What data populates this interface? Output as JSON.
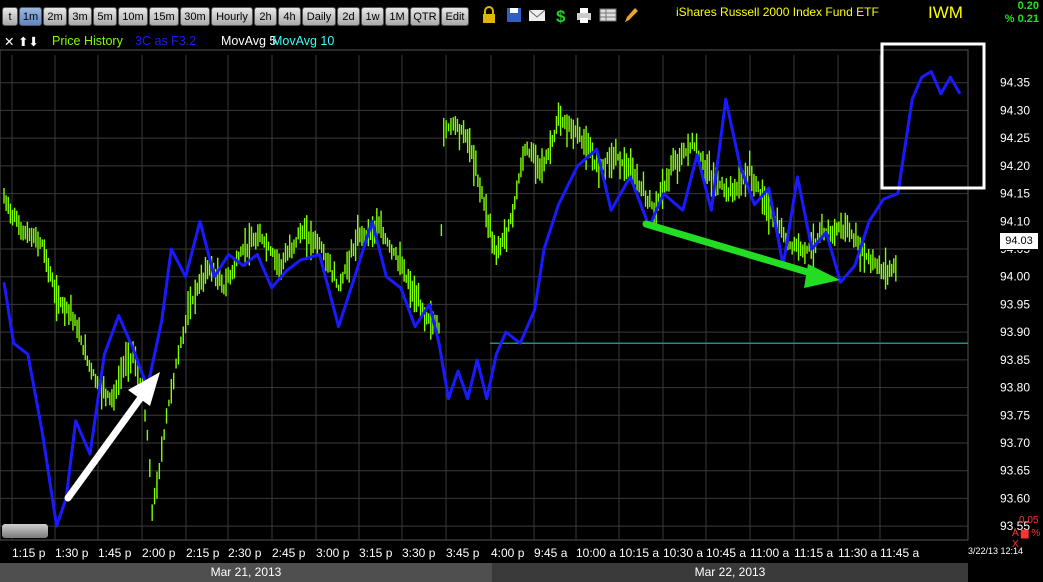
{
  "toolbar": {
    "timeframes": [
      "t",
      "1m",
      "2m",
      "3m",
      "5m",
      "10m",
      "15m",
      "30m",
      "Hourly",
      "2h",
      "4h",
      "Daily",
      "2d",
      "1w",
      "1M",
      "QTR",
      "Edit"
    ],
    "active": "1m",
    "icons": [
      "lock-icon",
      "save-icon",
      "mail-icon",
      "dollar-icon",
      "print-icon",
      "table-icon",
      "pencil-icon"
    ]
  },
  "header": {
    "title": "iShares Russell 2000 Index Fund ETF",
    "symbol": "IWM",
    "change_abs": "0.20",
    "change_pct": "% 0.21"
  },
  "legend": {
    "controls": "✕ ⬆⬇",
    "price_history": "Price History",
    "indicator": "3C as F3.2",
    "ma5": "MovAvg 5",
    "ma10": "MovAvg 10"
  },
  "last_price": "94.03",
  "footer": {
    "date1": "Mar 21, 2013",
    "date2": "Mar 22, 2013",
    "corner_date": "3/22/13 12:14",
    "neg_change": "0.05",
    "alert_marks": "A ▆ % X"
  },
  "colors": {
    "price": "#7fff00",
    "indicator": "#1a1aff",
    "grid": "#3a3a3a",
    "teal_line": "#1f8f80",
    "white_arrow": "#ffffff",
    "green_arrow": "#22dd22",
    "box": "#ffffff"
  },
  "chart_data": {
    "type": "line",
    "y_ticks": [
      "94.35",
      "94.30",
      "94.25",
      "94.20",
      "94.15",
      "94.10",
      "94.05",
      "94.00",
      "93.95",
      "93.90",
      "93.85",
      "93.80",
      "93.75",
      "93.70",
      "93.65",
      "93.60",
      "93.55"
    ],
    "ylim": [
      93.525,
      94.4
    ],
    "x_ticks": [
      "1:15 p",
      "1:30 p",
      "1:45 p",
      "2:00 p",
      "2:15 p",
      "2:30 p",
      "2:45 p",
      "3:00 p",
      "3:15 p",
      "3:30 p",
      "3:45 p",
      "4:00 p",
      "9:45 a",
      "10:00 a",
      "10:15 a",
      "10:30 a",
      "10:45 a",
      "11:00 a",
      "11:15 a",
      "11:30 a",
      "11:45 a"
    ],
    "price_series": [
      {
        "t": 0,
        "v": 94.14
      },
      {
        "t": 4,
        "v": 94.08
      },
      {
        "t": 8,
        "v": 94.06
      },
      {
        "t": 11,
        "v": 93.96
      },
      {
        "t": 14,
        "v": 93.94
      },
      {
        "t": 17,
        "v": 93.86
      },
      {
        "t": 20,
        "v": 93.8
      },
      {
        "t": 23,
        "v": 93.78
      },
      {
        "t": 25,
        "v": 93.84
      },
      {
        "t": 27,
        "v": 93.86
      },
      {
        "t": 29,
        "v": 93.79
      },
      {
        "t": 30,
        "v": 93.71
      },
      {
        "t": 31,
        "v": 93.58
      },
      {
        "t": 32,
        "v": 93.62
      },
      {
        "t": 34,
        "v": 93.75
      },
      {
        "t": 36,
        "v": 93.84
      },
      {
        "t": 38,
        "v": 93.92
      },
      {
        "t": 40,
        "v": 93.97
      },
      {
        "t": 43,
        "v": 94.02
      },
      {
        "t": 46,
        "v": 93.98
      },
      {
        "t": 50,
        "v": 94.05
      },
      {
        "t": 54,
        "v": 94.07
      },
      {
        "t": 58,
        "v": 94.02
      },
      {
        "t": 62,
        "v": 94.08
      },
      {
        "t": 66,
        "v": 94.06
      },
      {
        "t": 70,
        "v": 93.98
      },
      {
        "t": 74,
        "v": 94.07
      },
      {
        "t": 78,
        "v": 94.09
      },
      {
        "t": 82,
        "v": 94.04
      },
      {
        "t": 85,
        "v": 93.98
      },
      {
        "t": 88,
        "v": 93.93
      },
      {
        "t": 91,
        "v": 93.91
      },
      {
        "t": 92,
        "v": 94.26
      },
      {
        "t": 94,
        "v": 94.28
      },
      {
        "t": 97,
        "v": 94.25
      },
      {
        "t": 100,
        "v": 94.15
      },
      {
        "t": 103,
        "v": 94.04
      },
      {
        "t": 106,
        "v": 94.1
      },
      {
        "t": 109,
        "v": 94.23
      },
      {
        "t": 113,
        "v": 94.2
      },
      {
        "t": 116,
        "v": 94.28
      },
      {
        "t": 120,
        "v": 94.26
      },
      {
        "t": 124,
        "v": 94.2
      },
      {
        "t": 128,
        "v": 94.22
      },
      {
        "t": 132,
        "v": 94.18
      },
      {
        "t": 136,
        "v": 94.12
      },
      {
        "t": 140,
        "v": 94.2
      },
      {
        "t": 144,
        "v": 94.24
      },
      {
        "t": 148,
        "v": 94.18
      },
      {
        "t": 152,
        "v": 94.15
      },
      {
        "t": 156,
        "v": 94.19
      },
      {
        "t": 160,
        "v": 94.12
      },
      {
        "t": 164,
        "v": 94.06
      },
      {
        "t": 168,
        "v": 94.05
      },
      {
        "t": 172,
        "v": 94.08
      },
      {
        "t": 176,
        "v": 94.09
      },
      {
        "t": 180,
        "v": 94.04
      },
      {
        "t": 184,
        "v": 94.01
      },
      {
        "t": 187,
        "v": 94.02
      }
    ],
    "indicator_series": [
      {
        "t": 0,
        "v": 93.99
      },
      {
        "t": 2,
        "v": 93.88
      },
      {
        "t": 5,
        "v": 93.86
      },
      {
        "t": 8,
        "v": 93.72
      },
      {
        "t": 11,
        "v": 93.55
      },
      {
        "t": 13,
        "v": 93.6
      },
      {
        "t": 15,
        "v": 93.74
      },
      {
        "t": 18,
        "v": 93.68
      },
      {
        "t": 21,
        "v": 93.86
      },
      {
        "t": 24,
        "v": 93.93
      },
      {
        "t": 27,
        "v": 93.87
      },
      {
        "t": 30,
        "v": 93.8
      },
      {
        "t": 33,
        "v": 93.92
      },
      {
        "t": 35,
        "v": 94.05
      },
      {
        "t": 38,
        "v": 94.0
      },
      {
        "t": 41,
        "v": 94.1
      },
      {
        "t": 44,
        "v": 94.0
      },
      {
        "t": 47,
        "v": 94.04
      },
      {
        "t": 50,
        "v": 94.02
      },
      {
        "t": 53,
        "v": 94.04
      },
      {
        "t": 56,
        "v": 93.98
      },
      {
        "t": 59,
        "v": 94.01
      },
      {
        "t": 62,
        "v": 94.03
      },
      {
        "t": 66,
        "v": 94.04
      },
      {
        "t": 70,
        "v": 93.91
      },
      {
        "t": 73,
        "v": 93.99
      },
      {
        "t": 77,
        "v": 94.1
      },
      {
        "t": 80,
        "v": 94.0
      },
      {
        "t": 83,
        "v": 93.98
      },
      {
        "t": 86,
        "v": 93.91
      },
      {
        "t": 89,
        "v": 93.95
      },
      {
        "t": 91,
        "v": 93.88
      },
      {
        "t": 93,
        "v": 93.78
      },
      {
        "t": 95,
        "v": 93.83
      },
      {
        "t": 97,
        "v": 93.78
      },
      {
        "t": 99,
        "v": 93.85
      },
      {
        "t": 101,
        "v": 93.78
      },
      {
        "t": 103,
        "v": 93.86
      },
      {
        "t": 105,
        "v": 93.9
      },
      {
        "t": 108,
        "v": 93.88
      },
      {
        "t": 111,
        "v": 93.94
      },
      {
        "t": 113,
        "v": 94.05
      },
      {
        "t": 116,
        "v": 94.13
      },
      {
        "t": 120,
        "v": 94.2
      },
      {
        "t": 124,
        "v": 94.23
      },
      {
        "t": 127,
        "v": 94.12
      },
      {
        "t": 131,
        "v": 94.18
      },
      {
        "t": 135,
        "v": 94.09
      },
      {
        "t": 138,
        "v": 94.15
      },
      {
        "t": 142,
        "v": 94.12
      },
      {
        "t": 145,
        "v": 94.22
      },
      {
        "t": 148,
        "v": 94.12
      },
      {
        "t": 151,
        "v": 94.32
      },
      {
        "t": 154,
        "v": 94.2
      },
      {
        "t": 157,
        "v": 94.13
      },
      {
        "t": 160,
        "v": 94.16
      },
      {
        "t": 163,
        "v": 94.02
      },
      {
        "t": 166,
        "v": 94.18
      },
      {
        "t": 169,
        "v": 94.05
      },
      {
        "t": 172,
        "v": 94.08
      },
      {
        "t": 175,
        "v": 93.99
      },
      {
        "t": 178,
        "v": 94.02
      },
      {
        "t": 181,
        "v": 94.1
      },
      {
        "t": 184,
        "v": 94.14
      },
      {
        "t": 187,
        "v": 94.15
      },
      {
        "t": 190,
        "v": 94.32
      },
      {
        "t": 192,
        "v": 94.36
      },
      {
        "t": 194,
        "v": 94.37
      },
      {
        "t": 196,
        "v": 94.33
      },
      {
        "t": 198,
        "v": 94.36
      },
      {
        "t": 200,
        "v": 94.33
      }
    ],
    "reference_line": 93.88
  }
}
